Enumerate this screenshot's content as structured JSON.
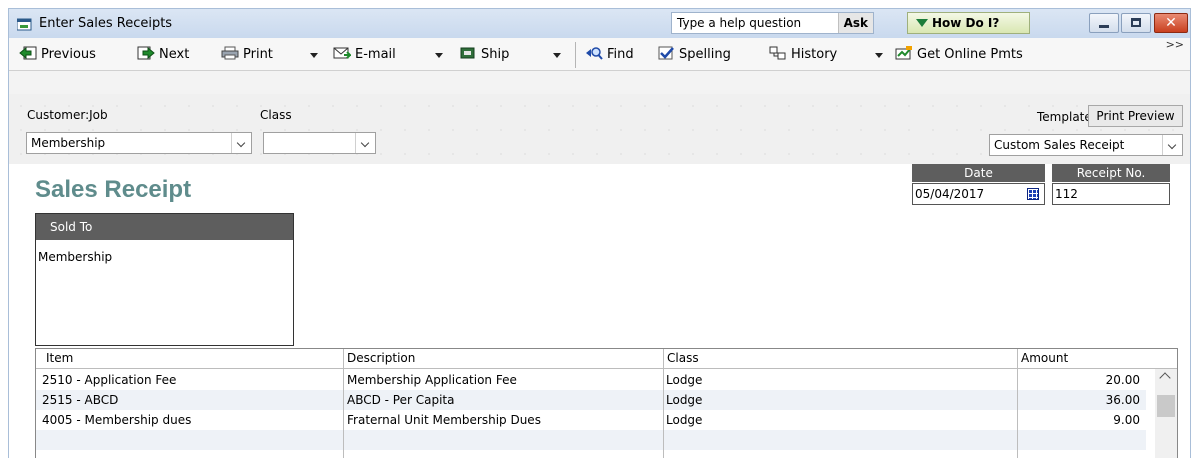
{
  "window": {
    "title": "Enter Sales Receipts",
    "help_placeholder": "Type a help question",
    "ask_label": "Ask",
    "how_do_i_label": "How Do I?"
  },
  "toolbar": {
    "previous": "Previous",
    "next": "Next",
    "print": "Print",
    "email": "E-mail",
    "ship": "Ship",
    "find": "Find",
    "spelling": "Spelling",
    "history": "History",
    "get_online_pmts": "Get Online Pmts",
    "more": ">>"
  },
  "header": {
    "customer_job_label": "Customer:Job",
    "customer_job_value": "Membership",
    "class_label": "Class",
    "class_value": "",
    "template_label": "Template",
    "print_preview_label": "Print Preview",
    "template_value": "Custom Sales Receipt"
  },
  "form": {
    "title": "Sales Receipt",
    "sold_to_label": "Sold To",
    "sold_to_value": "Membership",
    "date_label": "Date",
    "date_value": "05/04/2017",
    "receipt_no_label": "Receipt No.",
    "receipt_no_value": "112"
  },
  "grid": {
    "columns": [
      "Item",
      "Description",
      "Class",
      "Amount"
    ],
    "rows": [
      {
        "item": "2510 - Application Fee",
        "description": "Membership Application Fee",
        "class": "Lodge",
        "amount": "20.00"
      },
      {
        "item": "2515 - ABCD",
        "description": "ABCD - Per Capita",
        "class": "Lodge",
        "amount": "36.00"
      },
      {
        "item": "4005 - Membership dues",
        "description": "Fraternal Unit Membership Dues",
        "class": "Lodge",
        "amount": "9.00"
      }
    ]
  },
  "colors": {
    "title_teal": "#5f8c8c",
    "header_gray": "#5e5e5e",
    "row_alt": "#eef2f7"
  }
}
